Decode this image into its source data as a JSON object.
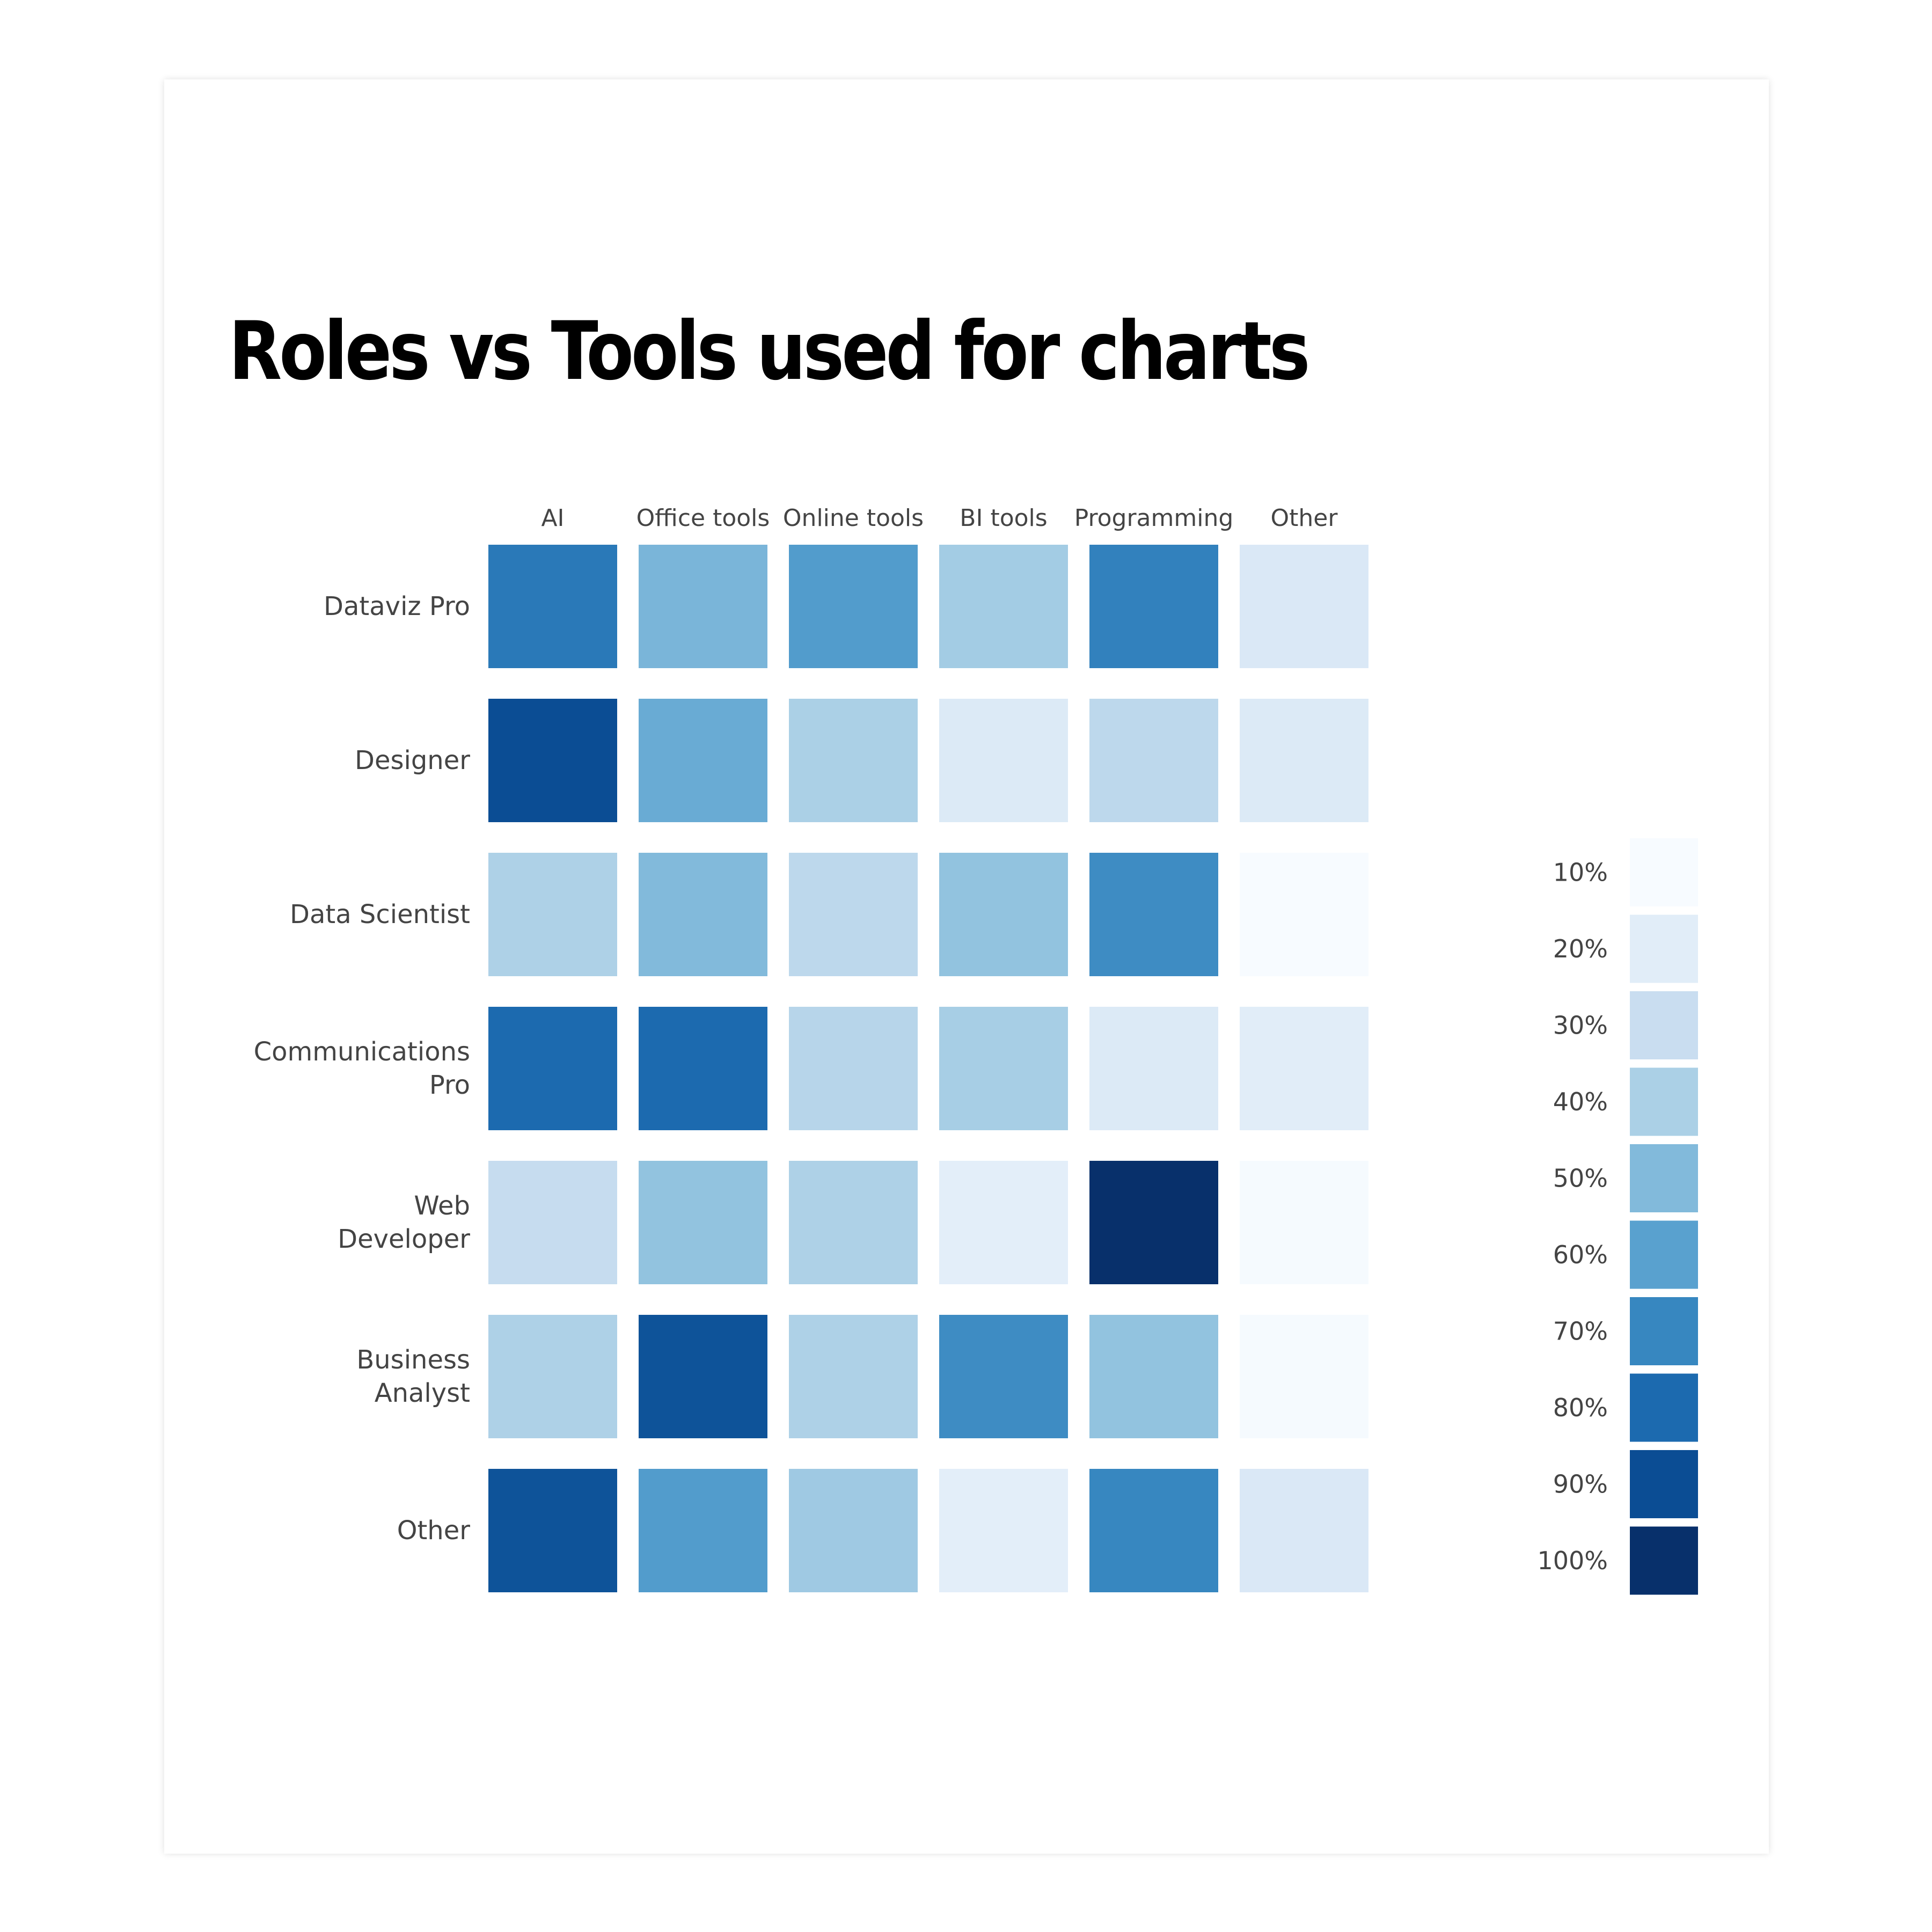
{
  "title": "Roles vs Tools used for charts",
  "chart_data": {
    "type": "heatmap",
    "title": "Roles vs Tools used for charts",
    "xlabel": "",
    "ylabel": "",
    "columns": [
      "AI",
      "Office tools",
      "Online tools",
      "BI tools",
      "Programming",
      "Other"
    ],
    "rows": [
      {
        "label": [
          "Dataviz Pro"
        ],
        "values": [
          75,
          52,
          62,
          42,
          72,
          23
        ]
      },
      {
        "label": [
          "Designer"
        ],
        "values": [
          90,
          56,
          40,
          22,
          34,
          22
        ]
      },
      {
        "label": [
          "Data Scientist"
        ],
        "values": [
          39,
          50,
          34,
          46,
          68,
          10
        ]
      },
      {
        "label": [
          "Communications",
          "Pro"
        ],
        "values": [
          80,
          80,
          36,
          41,
          22,
          20
        ]
      },
      {
        "label": [
          "Web",
          "Developer"
        ],
        "values": [
          31,
          46,
          39,
          19,
          100,
          11
        ]
      },
      {
        "label": [
          "Business",
          "Analyst"
        ],
        "values": [
          39,
          88,
          39,
          68,
          46,
          11
        ]
      },
      {
        "label": [
          "Other"
        ],
        "values": [
          88,
          62,
          43,
          19,
          70,
          23
        ]
      }
    ],
    "value_unit": "%",
    "value_range": [
      10,
      100
    ],
    "colorscale": "Blues",
    "legend": {
      "position": "right",
      "entries": [
        {
          "label": "10%",
          "value": 10,
          "color": "#f7fbff"
        },
        {
          "label": "20%",
          "value": 20,
          "color": "#e1edf8"
        },
        {
          "label": "30%",
          "value": 30,
          "color": "#c9ddf0"
        },
        {
          "label": "40%",
          "value": 40,
          "color": "#abd0e6"
        },
        {
          "label": "50%",
          "value": 50,
          "color": "#82badb"
        },
        {
          "label": "60%",
          "value": 60,
          "color": "#59a1cf"
        },
        {
          "label": "70%",
          "value": 70,
          "color": "#3787c0"
        },
        {
          "label": "80%",
          "value": 80,
          "color": "#1c6aaf"
        },
        {
          "label": "90%",
          "value": 90,
          "color": "#0b4d94"
        },
        {
          "label": "100%",
          "value": 100,
          "color": "#08306b"
        }
      ]
    }
  }
}
